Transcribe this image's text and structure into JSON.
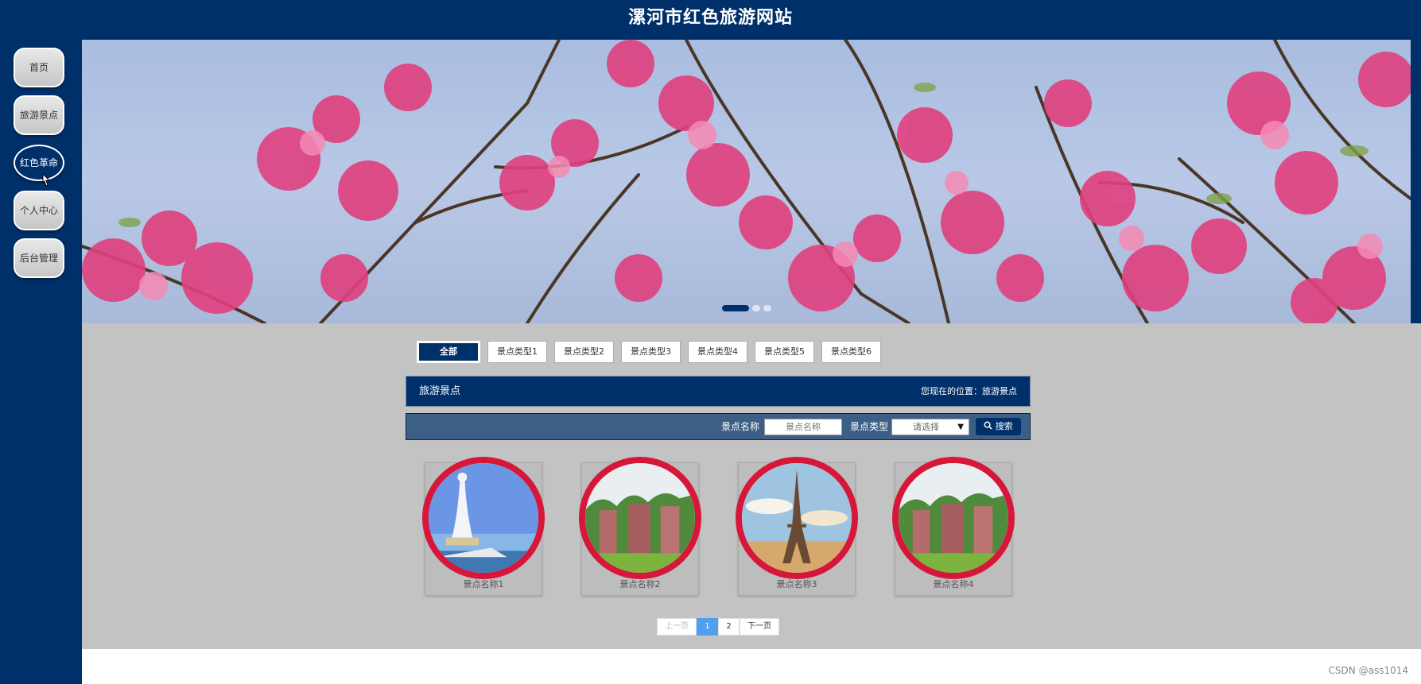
{
  "header": {
    "title": "漯河市红色旅游网站"
  },
  "sidebar": {
    "items": [
      {
        "label": "首页"
      },
      {
        "label": "旅游景点"
      },
      {
        "label": "红色革命"
      },
      {
        "label": "个人中心"
      },
      {
        "label": "后台管理"
      }
    ],
    "active_index": 2
  },
  "banner": {
    "dots": 3,
    "active_dot": 0
  },
  "tabs": [
    {
      "label": "全部"
    },
    {
      "label": "景点类型1"
    },
    {
      "label": "景点类型2"
    },
    {
      "label": "景点类型3"
    },
    {
      "label": "景点类型4"
    },
    {
      "label": "景点类型5"
    },
    {
      "label": "景点类型6"
    }
  ],
  "breadcrumb": {
    "section": "旅游景点",
    "location": "您现在的位置：旅游景点"
  },
  "search": {
    "name_label": "景点名称",
    "name_placeholder": "景点名称",
    "type_label": "景点类型",
    "type_selected": "请选择",
    "button_label": "搜索"
  },
  "cards": [
    {
      "name": "景点名称1",
      "image": "statue-sea"
    },
    {
      "name": "景点名称2",
      "image": "green-cliffs"
    },
    {
      "name": "景点名称3",
      "image": "eiffel-tower"
    },
    {
      "name": "景点名称4",
      "image": "green-cliffs"
    }
  ],
  "pagination": {
    "prev": "上一页",
    "pages": [
      "1",
      "2"
    ],
    "current": "1",
    "next": "下一页"
  },
  "watermark": "CSDN @ass1014",
  "colors": {
    "primary": "#00306a",
    "content_bg": "#c3c3c3",
    "ring": "#d6173a",
    "pager_active": "#4f9fef"
  }
}
